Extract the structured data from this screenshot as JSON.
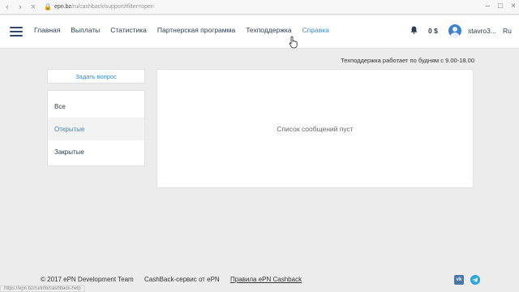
{
  "browser": {
    "url_domain": "epn.bz",
    "url_path": "/ru/cashback/support#filter=open",
    "status_url": "https://epn.bz/ru/info/cashback-help"
  },
  "header": {
    "nav": [
      {
        "label": "Главная",
        "active": false
      },
      {
        "label": "Выплаты",
        "active": false
      },
      {
        "label": "Статистика",
        "active": false
      },
      {
        "label": "Партнерская программа",
        "active": false
      },
      {
        "label": "Техподдержка",
        "active": false
      },
      {
        "label": "Справка",
        "active": true
      }
    ],
    "balance": "0 $",
    "username": "stavro3...",
    "language": "Ru"
  },
  "support": {
    "hours_notice": "Техподдержка работает по будням с 9.00-18.00",
    "ask_button": "Задать вопрос",
    "filters": [
      "Все",
      "Открытые",
      "Закрытые"
    ],
    "active_filter": "Открытые",
    "empty_message": "Список сообщений пуст"
  },
  "footer": {
    "copyright": "© 2017 ePN Development Team",
    "link_cashback": "CashBack-сервис от ePN",
    "link_rules": "Правила ePN Cashback",
    "vk_label": "vk"
  },
  "colors": {
    "accent": "#3a87c8",
    "nav_text": "#2c3e50",
    "background": "#ececec",
    "vk": "#4a76a8",
    "telegram": "#2ca5e0"
  }
}
